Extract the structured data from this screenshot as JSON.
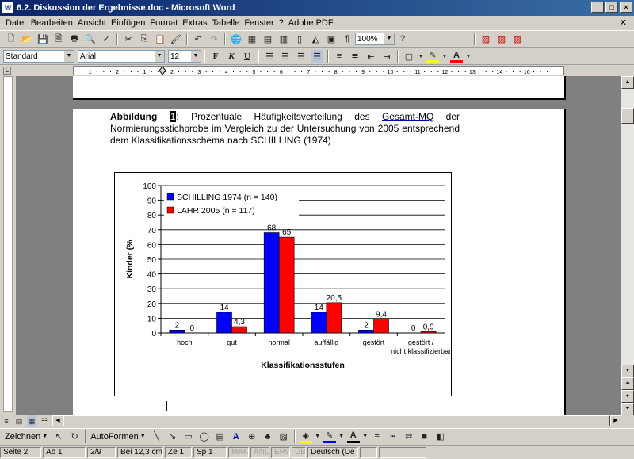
{
  "window": {
    "title": "6.2. Diskussion der Ergebnisse.doc - Microsoft Word",
    "icon_letter": "W"
  },
  "menu": [
    "Datei",
    "Bearbeiten",
    "Ansicht",
    "Einfügen",
    "Format",
    "Extras",
    "Tabelle",
    "Fenster",
    "?",
    "Adobe PDF"
  ],
  "format_toolbar": {
    "style": "Standard",
    "font": "Arial",
    "size": "12",
    "zoom": "100%"
  },
  "ruler": {
    "labels": [
      "1",
      "2",
      "1",
      "2",
      "3",
      "4",
      "5",
      "6",
      "7",
      "8",
      "9",
      "10",
      "11",
      "12",
      "13",
      "14",
      "16"
    ]
  },
  "document": {
    "caption_bold": "Abbildung",
    "caption_num": "1",
    "caption_pre": ": Prozentuale Häufigkeitsverteilung des ",
    "caption_link": "Gesamt-MQ",
    "caption_post": " der Normierungsstichprobe im Vergleich zu der Untersuchung von 2005 entsprechend dem Klassifikationsschema nach SCHILLING (1974)"
  },
  "chart_data": {
    "type": "bar",
    "xlabel": "Klassifikationsstufen",
    "ylabel": "Kinder (%",
    "ylim": [
      0,
      100
    ],
    "yticks": [
      0,
      10,
      20,
      30,
      40,
      50,
      60,
      70,
      80,
      90,
      100
    ],
    "grid": true,
    "legend_position": "top-left",
    "categories": [
      "hoch",
      "gut",
      "normal",
      "auffällig",
      "gestört",
      "gestört / nicht klassifizierbar"
    ],
    "series": [
      {
        "name": "SCHILLING 1974 (n = 140)",
        "color": "#0000ff",
        "values": [
          2,
          14,
          68,
          14,
          2,
          0
        ],
        "labels": [
          "2",
          "14",
          "68",
          "14",
          "2",
          "0"
        ]
      },
      {
        "name": "LAHR 2005 (n = 117)",
        "color": "#ff0000",
        "values": [
          0,
          4.3,
          65,
          20.5,
          9.4,
          0.9
        ],
        "labels": [
          "0",
          "4,3",
          "65",
          "20,5",
          "9,4",
          "0,9"
        ]
      }
    ]
  },
  "drawing_toolbar": {
    "draw_label": "Zeichnen",
    "autoshapes_label": "AutoFormen"
  },
  "status": {
    "page": "Seite  2",
    "section": "Ab  1",
    "pages": "2/9",
    "pos": "Bei  12,3 cm",
    "line": "Ze  1",
    "col": "Sp  1",
    "mak": "MAK",
    "and": "ÄND",
    "erw": "ERW",
    "ub": "ÜB",
    "lang": "Deutsch (De"
  }
}
